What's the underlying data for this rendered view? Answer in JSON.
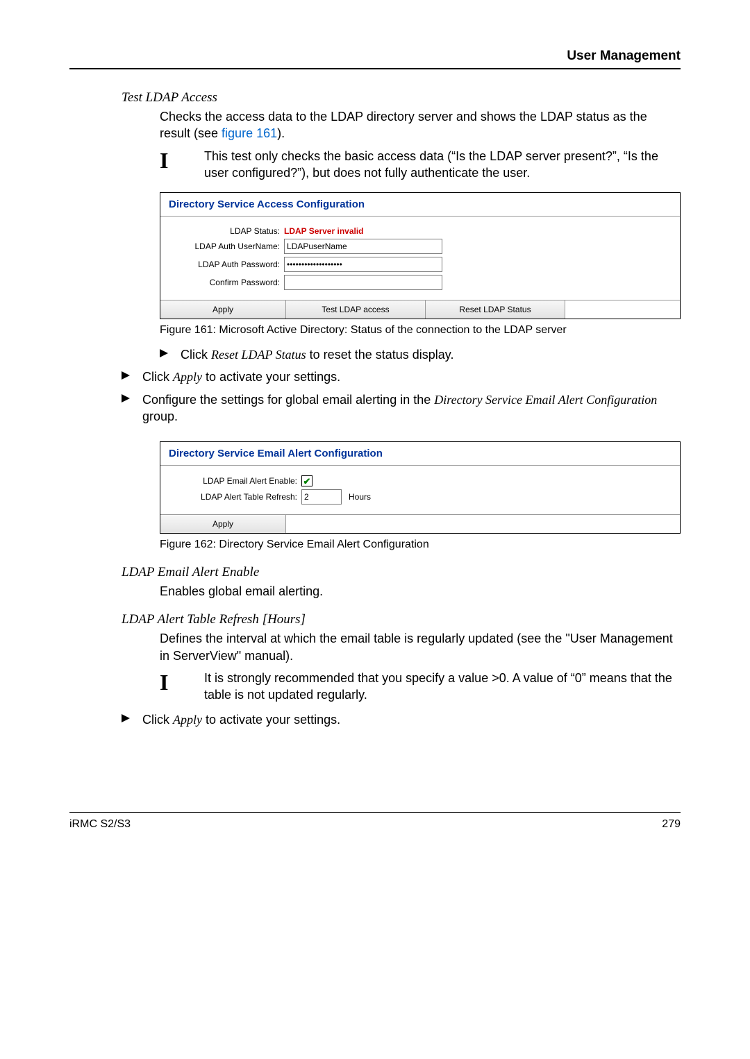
{
  "header": {
    "title": "User Management"
  },
  "section_test_ldap_access": {
    "heading": "Test LDAP Access",
    "desc_pre": "Checks the access data to the LDAP directory server and shows the LDAP status as the result (see ",
    "desc_link": "figure 161",
    "desc_post": ").",
    "note": "This test only checks the basic access data (“Is the LDAP server present?”, “Is the user configured?”), but does not fully authenticate the user."
  },
  "panel1": {
    "title": "Directory Service Access Configuration",
    "rows": {
      "status_label": "LDAP Status:",
      "status_value": "LDAP Server invalid",
      "username_label": "LDAP Auth UserName:",
      "username_value": "LDAPuserName",
      "password_label": "LDAP Auth Password:",
      "password_value": "•••••••••••••••••••",
      "confirm_label": "Confirm Password:",
      "confirm_value": ""
    },
    "buttons": {
      "apply": "Apply",
      "test": "Test LDAP access",
      "reset": "Reset LDAP Status"
    }
  },
  "caption1": "Figure 161: Microsoft Active Directory: Status of the connection to the LDAP server",
  "bullets": {
    "reset_pre": "Click ",
    "reset_em": "Reset LDAP Status",
    "reset_post": " to reset the status display.",
    "apply1_pre": "Click ",
    "apply1_em": "Apply",
    "apply1_post": " to activate your settings.",
    "config_pre": "Configure the settings for global email alerting in the ",
    "config_em": "Directory Service Email Alert Configuration",
    "config_post": " group."
  },
  "panel2": {
    "title": "Directory Service Email Alert Configuration",
    "rows": {
      "enable_label": "LDAP Email Alert Enable:",
      "refresh_label": "LDAP Alert Table Refresh:",
      "refresh_value": "2",
      "hours_label": "Hours"
    },
    "buttons": {
      "apply": "Apply"
    }
  },
  "caption2": "Figure 162: Directory Service Email Alert Configuration",
  "section_email_enable": {
    "heading": "LDAP Email Alert Enable",
    "desc": "Enables global email alerting."
  },
  "section_table_refresh": {
    "heading": "LDAP Alert Table Refresh [Hours]",
    "desc": "Defines the interval at which the email table is regularly updated (see the \"User Management in ServerView\" manual).",
    "note": "It is strongly recommended that you specify a value >0. A value of “0” means that the table is not updated regularly."
  },
  "apply2": {
    "pre": "Click ",
    "em": "Apply",
    "post": " to activate your settings."
  },
  "footer": {
    "left": "iRMC S2/S3",
    "right": "279"
  }
}
